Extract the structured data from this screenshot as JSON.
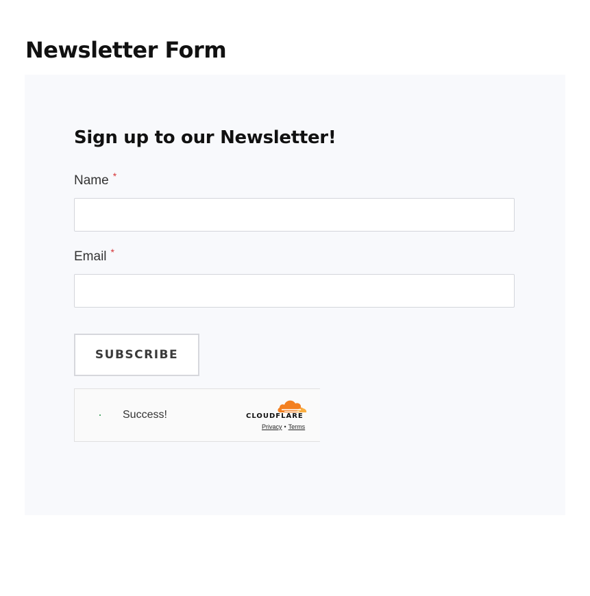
{
  "page": {
    "title": "Newsletter Form"
  },
  "form": {
    "heading": "Sign up to our Newsletter!",
    "fields": [
      {
        "label": "Name",
        "required_marker": "*",
        "value": "",
        "placeholder": ""
      },
      {
        "label": "Email",
        "required_marker": "*",
        "value": "",
        "placeholder": ""
      }
    ],
    "submit_label": "SUBSCRIBE"
  },
  "captcha": {
    "status_text": "Success!",
    "brand": "CLOUDFLARE",
    "privacy_label": "Privacy",
    "separator": "•",
    "terms_label": "Terms",
    "brand_color": "#f38020",
    "success_color": "#1a8f3c"
  },
  "colors": {
    "panel_background": "#f8f9fc",
    "required_marker": "#d63638"
  }
}
